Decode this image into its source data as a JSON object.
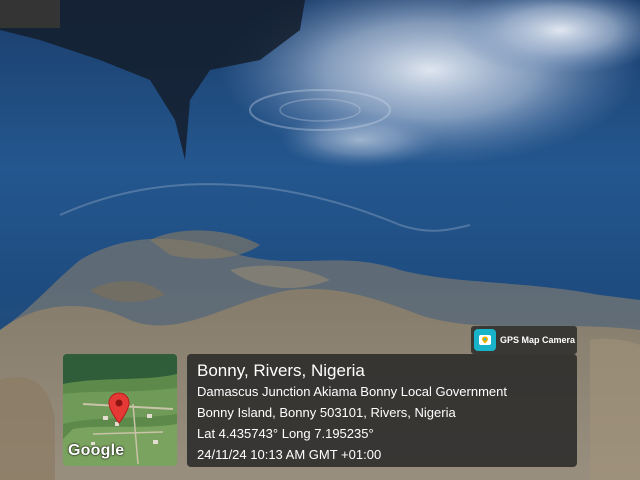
{
  "location_stamp": {
    "app_badge_label": "GPS Map Camera",
    "map_logo": "Google",
    "title": "Bonny, Rivers, Nigeria",
    "address_line": "Damascus Junction Akiama Bonny Local Government",
    "locality_line": "Bonny Island, Bonny 503101, Rivers, Nigeria",
    "coordinates": "Lat 4.435743° Long 7.195235°",
    "timestamp": "24/11/24 10:13 AM GMT +01:00"
  },
  "icons": {
    "app_icon": "gps-map-camera-icon",
    "map_marker": "map-pin-icon"
  },
  "colors": {
    "panel_background": "#262626",
    "pin_red": "#e53935",
    "app_icon_teal": "#19b3c9",
    "water_blue": "#1d4f7e"
  }
}
